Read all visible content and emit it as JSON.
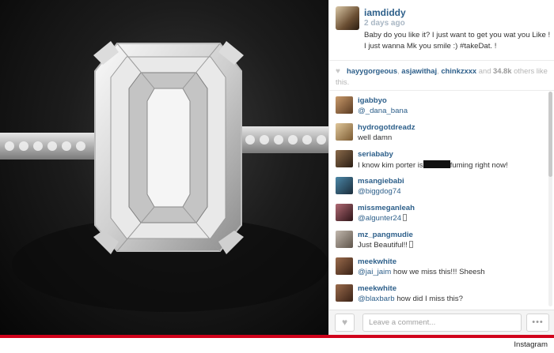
{
  "post": {
    "username": "iamdiddy",
    "time": "2 days ago",
    "caption": "Baby do you like it? I just want to get you wat you Like ! I just wanna Mk you smile :) #takeDat. !"
  },
  "likes": {
    "icon": "heart-icon",
    "likers": [
      "hayygorgeous",
      "asjawithaj",
      "chinkzxxx"
    ],
    "sep1": ", ",
    "sep2": ", ",
    "and_text": " and ",
    "count": "34.8k",
    "suffix": " others like this."
  },
  "comments": [
    {
      "user": "igabbyo",
      "mention": "@_dana_bana",
      "text": ""
    },
    {
      "user": "hydrogotdreadz",
      "mention": "",
      "text": "well damn"
    },
    {
      "user": "seriababy",
      "mention": "",
      "text_before": "I know kim porter is",
      "text_after": "fuming right now!"
    },
    {
      "user": "msangiebabi",
      "mention": "@biggdog74",
      "text": ""
    },
    {
      "user": "missmeganleah",
      "mention": "@algunter24",
      "text": ""
    },
    {
      "user": "mz_pangmudie",
      "mention": "",
      "text": "Just Beautiful!!"
    },
    {
      "user": "meekwhite",
      "mention": "@jai_jaim",
      "text": " how we miss this!!! Sheesh"
    },
    {
      "user": "meekwhite",
      "mention": "@blaxbarb",
      "text": " how did I miss this?"
    }
  ],
  "comment_input": {
    "placeholder": "Leave a comment..."
  },
  "buttons": {
    "more": "•••"
  },
  "watermark": "Instagram",
  "colors": {
    "link": "#2d5f8a",
    "accent_red": "#d0021b"
  }
}
